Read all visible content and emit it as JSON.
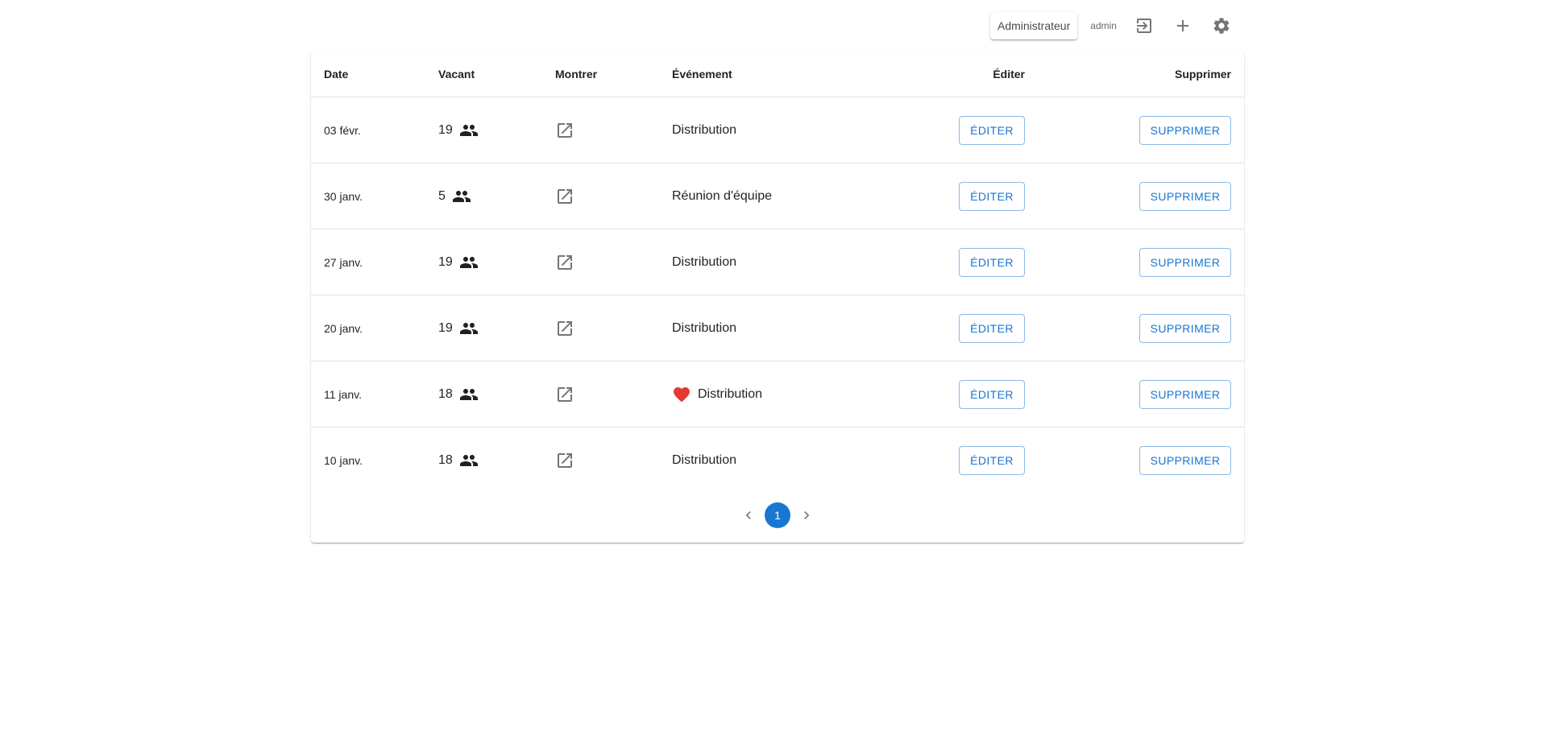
{
  "header": {
    "role_label": "Administrateur",
    "username": "admin",
    "icons": [
      "logout-icon",
      "add-icon",
      "settings-icon"
    ]
  },
  "table": {
    "columns": {
      "date": "Date",
      "vacant": "Vacant",
      "show": "Montrer",
      "event": "Événement",
      "edit": "Éditer",
      "delete": "Supprimer"
    },
    "rows": [
      {
        "date": "03 févr.",
        "vacant": "19",
        "event": "Distribution",
        "favorite": false,
        "edit_label": "ÉDITER",
        "delete_label": "SUPPRIMER"
      },
      {
        "date": "30 janv.",
        "vacant": "5",
        "event": "Réunion d'équipe",
        "favorite": false,
        "edit_label": "ÉDITER",
        "delete_label": "SUPPRIMER"
      },
      {
        "date": "27 janv.",
        "vacant": "19",
        "event": "Distribution",
        "favorite": false,
        "edit_label": "ÉDITER",
        "delete_label": "SUPPRIMER"
      },
      {
        "date": "20 janv.",
        "vacant": "19",
        "event": "Distribution",
        "favorite": false,
        "edit_label": "ÉDITER",
        "delete_label": "SUPPRIMER"
      },
      {
        "date": "11 janv.",
        "vacant": "18",
        "event": "Distribution",
        "favorite": true,
        "edit_label": "ÉDITER",
        "delete_label": "SUPPRIMER"
      },
      {
        "date": "10 janv.",
        "vacant": "18",
        "event": "Distribution",
        "favorite": false,
        "edit_label": "ÉDITER",
        "delete_label": "SUPPRIMER"
      }
    ]
  },
  "pagination": {
    "current_page": "1"
  },
  "colors": {
    "primary": "#1976d2",
    "heart": "#e53935"
  }
}
